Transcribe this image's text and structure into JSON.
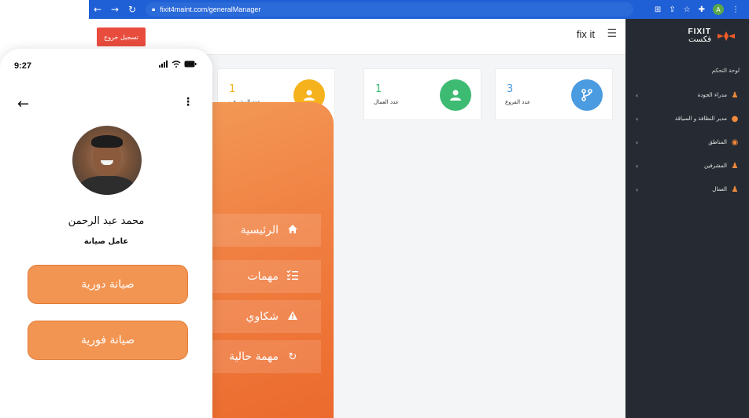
{
  "browser": {
    "url": "fixit4maint.com/generalManager"
  },
  "header": {
    "logout_label": "تسجيل خروج",
    "brand": "fix it"
  },
  "cards": [
    {
      "value": "3",
      "label": "عدد الفروع",
      "color": "#4a9be0",
      "icon": "branch-icon"
    },
    {
      "value": "1",
      "label": "عدد العمال",
      "color": "#3dbb72",
      "icon": "user-icon"
    },
    {
      "value": "1",
      "label": "عدد المشرفين",
      "color": "#f6b21c",
      "icon": "supervisor-icon"
    }
  ],
  "sidebar": {
    "logo_en": "FIXIT",
    "logo_ar": "فكست",
    "title": "لوحة التحكم",
    "items": [
      {
        "label": "مدراء الجودة",
        "icon": "quality-manager-icon"
      },
      {
        "label": "مدير النظافة و السياقة",
        "icon": "cleaning-manager-icon"
      },
      {
        "label": "المناطق",
        "icon": "location-pin-icon"
      },
      {
        "label": "المشرفين",
        "icon": "supervisor-icon"
      },
      {
        "label": "العمال",
        "icon": "worker-icon"
      }
    ]
  },
  "orange_menu": {
    "items": [
      {
        "label": "الرئيسية",
        "icon": "home-icon"
      },
      {
        "label": "مهمات",
        "icon": "tasks-list-icon"
      },
      {
        "label": "شكاوي",
        "icon": "warning-icon"
      },
      {
        "label": "مهمة حالية",
        "icon": "refresh-icon"
      }
    ]
  },
  "phone": {
    "time": "9:27",
    "user_name": "محمد عبد الرحمن",
    "user_role": "عامل صيانة",
    "buttons": [
      {
        "label": "صيانة دورية"
      },
      {
        "label": "صيانة فورية"
      }
    ]
  },
  "colors": {
    "accent_orange": "#f39552",
    "logout_red": "#e84c3d",
    "sidebar_dark": "#262b33",
    "chrome_blue": "#1f60d6"
  }
}
